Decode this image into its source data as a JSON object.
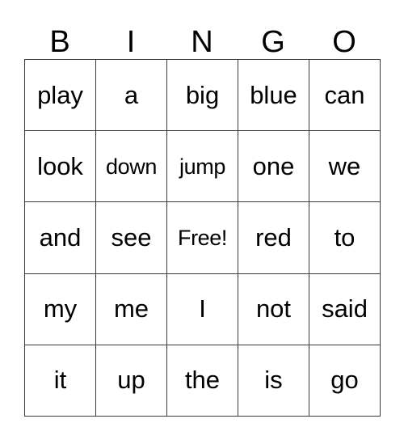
{
  "card": {
    "title": "BINGO",
    "headers": [
      "B",
      "I",
      "N",
      "G",
      "O"
    ],
    "grid_rows": [
      {
        "cells": [
          {
            "text": "play"
          },
          {
            "text": "a"
          },
          {
            "text": "big"
          },
          {
            "text": "blue"
          },
          {
            "text": "can"
          }
        ]
      },
      {
        "cells": [
          {
            "text": "look"
          },
          {
            "text": "down"
          },
          {
            "text": "jump"
          },
          {
            "text": "one"
          },
          {
            "text": "we"
          }
        ]
      },
      {
        "cells": [
          {
            "text": "and"
          },
          {
            "text": "see"
          },
          {
            "text": "Free!"
          },
          {
            "text": "red"
          },
          {
            "text": "to"
          }
        ]
      },
      {
        "cells": [
          {
            "text": "my"
          },
          {
            "text": "me"
          },
          {
            "text": "I"
          },
          {
            "text": "not"
          },
          {
            "text": "said"
          }
        ]
      },
      {
        "cells": [
          {
            "text": "it"
          },
          {
            "text": "up"
          },
          {
            "text": "the"
          },
          {
            "text": "is"
          },
          {
            "text": "go"
          }
        ]
      }
    ],
    "free_space_text": "Free!",
    "colors": {
      "background": "#ffffff",
      "text": "#000000",
      "grid_line": "#3a3a3a"
    }
  }
}
